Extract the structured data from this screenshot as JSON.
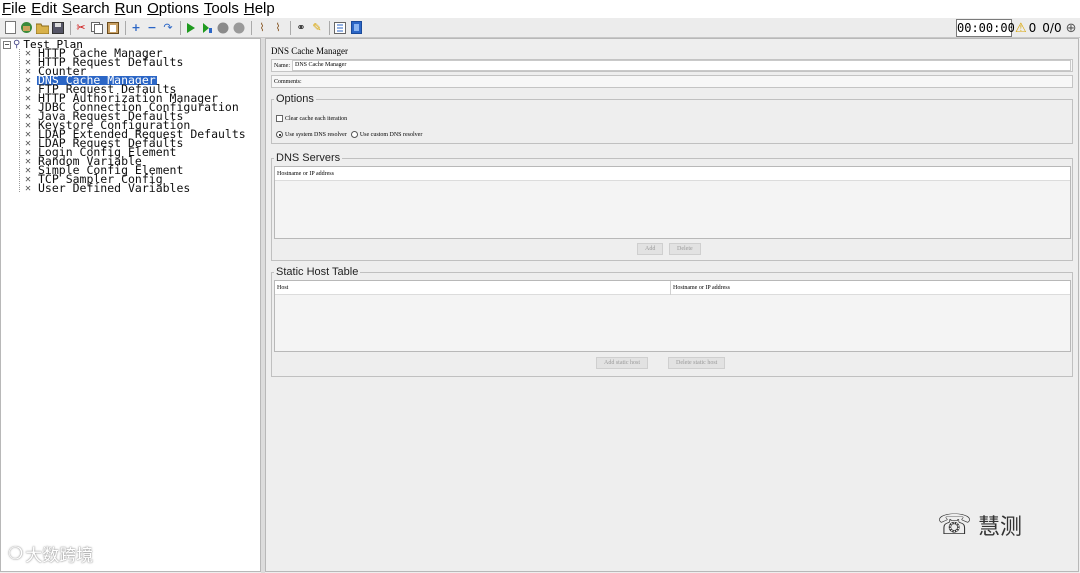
{
  "menu": [
    {
      "label": "File",
      "mnemonic": "F",
      "rest": "ile"
    },
    {
      "label": "Edit",
      "mnemonic": "E",
      "rest": "dit"
    },
    {
      "label": "Search",
      "mnemonic": "S",
      "rest": "earch"
    },
    {
      "label": "Run",
      "mnemonic": "R",
      "rest": "un"
    },
    {
      "label": "Options",
      "mnemonic": "O",
      "rest": "ptions"
    },
    {
      "label": "Tools",
      "mnemonic": "T",
      "rest": "ools"
    },
    {
      "label": "Help",
      "mnemonic": "H",
      "rest": "elp"
    }
  ],
  "toolbar": {
    "timer": "00:00:00",
    "warnings": "0",
    "threads": "0/0"
  },
  "tree": {
    "root": "Test Plan",
    "items": [
      "HTTP Cache Manager",
      "HTTP Request Defaults",
      "Counter",
      "DNS Cache Manager",
      "FTP Request Defaults",
      "HTTP Authorization Manager",
      "JDBC Connection Configuration",
      "Java Request Defaults",
      "Keystore Configuration",
      "LDAP Extended Request Defaults",
      "LDAP Request Defaults",
      "Login Config Element",
      "Random Variable",
      "Simple Config Element",
      "TCP Sampler Config",
      "User Defined Variables"
    ],
    "selected_index": 3
  },
  "panel": {
    "title": "DNS Cache Manager",
    "name_label": "Name:",
    "name_value": "DNS Cache Manager",
    "comments_label": "Comments:",
    "comments_value": ""
  },
  "options": {
    "legend": "Options",
    "clear_cache_label": "Clear cache each iteration",
    "system_resolver_label": "Use system DNS resolver",
    "custom_resolver_label": "Use custom DNS resolver"
  },
  "dns_servers": {
    "legend": "DNS Servers",
    "column": "Hostname or IP address",
    "add_label": "Add",
    "delete_label": "Delete"
  },
  "static_hosts": {
    "legend": "Static Host Table",
    "columns": [
      "Host",
      "Hostname or IP address"
    ],
    "add_label": "Add static host",
    "delete_label": "Delete static host"
  },
  "watermarks": {
    "left": "大数跨境",
    "right": "慧测"
  }
}
